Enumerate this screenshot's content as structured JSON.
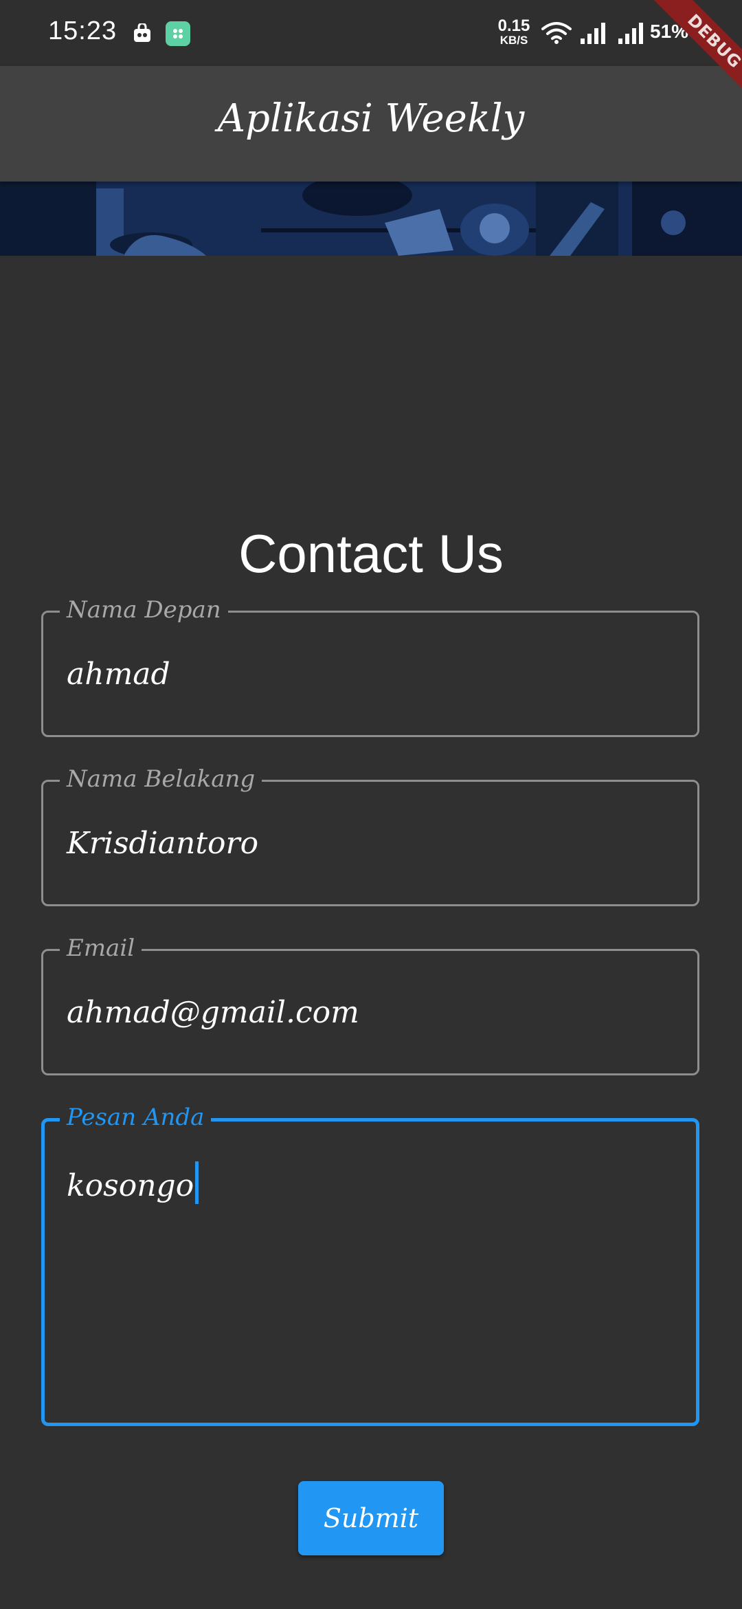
{
  "status_bar": {
    "time": "15:23",
    "net_speed_value": "0.15",
    "net_speed_unit": "KB/S",
    "battery": "51%",
    "icons": [
      "notification-bag-icon",
      "notification-app-icon",
      "wifi-icon",
      "signal-icon",
      "signal-icon",
      "battery-icon"
    ]
  },
  "debug_banner": "DEBUG",
  "app_bar": {
    "title": "Aplikasi Weekly"
  },
  "form": {
    "heading": "Contact Us",
    "fields": [
      {
        "label": "Nama Depan",
        "value": "ahmad"
      },
      {
        "label": "Nama Belakang",
        "value": "Krisdiantoro"
      },
      {
        "label": "Email",
        "value": "ahmad@gmail.com"
      },
      {
        "label": "Pesan Anda",
        "value": "kosongo",
        "focused": true
      }
    ],
    "submit_label": "Submit"
  },
  "colors": {
    "background": "#303030",
    "app_bar": "#424242",
    "accent": "#2196f3",
    "field_border": "#8e8e8e",
    "label": "#a8a8a8",
    "debug_banner": "#8b1e1e"
  }
}
